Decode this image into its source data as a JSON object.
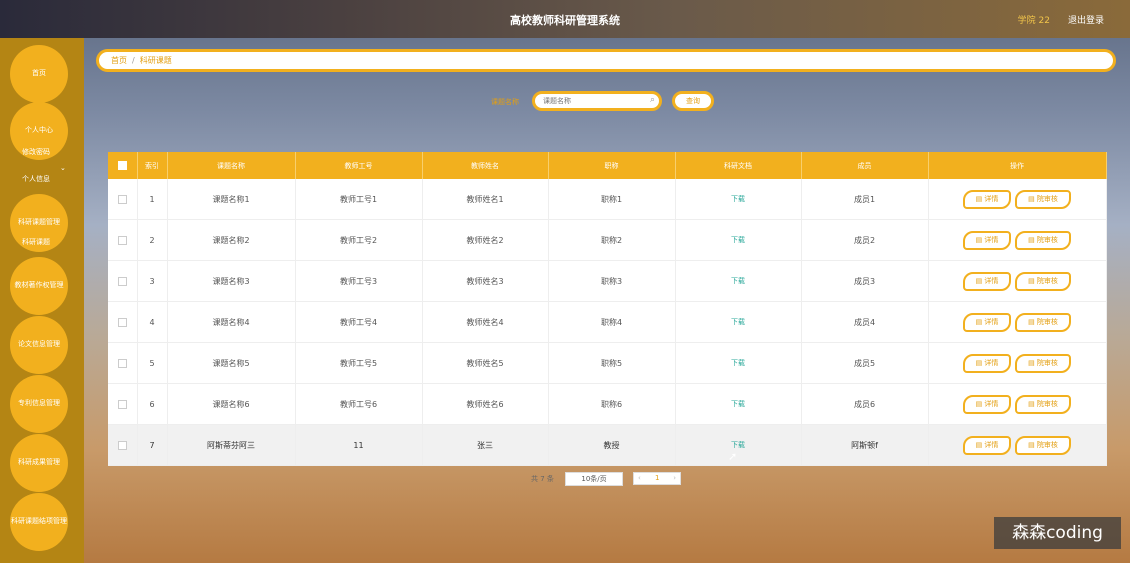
{
  "header": {
    "title": "高校教师科研管理系统",
    "user": "学院 22",
    "logout": "退出登录"
  },
  "sidebar": {
    "home": "首页",
    "personal_center": "个人中心",
    "change_password": "修改密码",
    "personal_info": "个人信息",
    "project_mgmt": "科研课题管理",
    "project": "科研课题",
    "textbook_mgmt": "教材著作权管理",
    "paper_mgmt": "论文信息管理",
    "patent_mgmt": "专利信息管理",
    "result_mgmt": "科研成果管理",
    "closure_mgmt": "科研课题结项管理"
  },
  "breadcrumb": {
    "home": "首页",
    "separator": "/",
    "current": "科研课题"
  },
  "search": {
    "label": "课题名称",
    "placeholder": "课题名称",
    "button": "查询"
  },
  "table": {
    "headers": [
      "索引",
      "课题名称",
      "教师工号",
      "教师姓名",
      "职称",
      "科研文档",
      "成员",
      "操作"
    ],
    "rows": [
      {
        "index": "1",
        "title": "课题名称1",
        "teacher_no": "教师工号1",
        "teacher_name": "教师姓名1",
        "rank": "职称1",
        "doc": "下载",
        "member": "成员1"
      },
      {
        "index": "2",
        "title": "课题名称2",
        "teacher_no": "教师工号2",
        "teacher_name": "教师姓名2",
        "rank": "职称2",
        "doc": "下载",
        "member": "成员2"
      },
      {
        "index": "3",
        "title": "课题名称3",
        "teacher_no": "教师工号3",
        "teacher_name": "教师姓名3",
        "rank": "职称3",
        "doc": "下载",
        "member": "成员3"
      },
      {
        "index": "4",
        "title": "课题名称4",
        "teacher_no": "教师工号4",
        "teacher_name": "教师姓名4",
        "rank": "职称4",
        "doc": "下载",
        "member": "成员4"
      },
      {
        "index": "5",
        "title": "课题名称5",
        "teacher_no": "教师工号5",
        "teacher_name": "教师姓名5",
        "rank": "职称5",
        "doc": "下载",
        "member": "成员5"
      },
      {
        "index": "6",
        "title": "课题名称6",
        "teacher_no": "教师工号6",
        "teacher_name": "教师姓名6",
        "rank": "职称6",
        "doc": "下载",
        "member": "成员6"
      },
      {
        "index": "7",
        "title": "阿斯蒂芬阿三",
        "teacher_no": "11",
        "teacher_name": "张三",
        "rank": "教授",
        "doc": "下载",
        "member": "阿斯顿f"
      }
    ],
    "action_detail": "详情",
    "action_review": "院审核"
  },
  "pagination": {
    "total": "共 7 条",
    "page_size": "10条/页",
    "prev": "‹",
    "current": "1",
    "next": "›"
  },
  "watermark": "森森coding",
  "icons": {
    "search": "search-icon",
    "chevron": "chevron-down-icon",
    "cursor": "mouse-cursor-icon",
    "doc": "document-icon"
  },
  "colors": {
    "accent": "#f2b01e",
    "sidebar_bg": "#b48514",
    "accent_text": "#e39f12",
    "link": "#2aa89a"
  }
}
